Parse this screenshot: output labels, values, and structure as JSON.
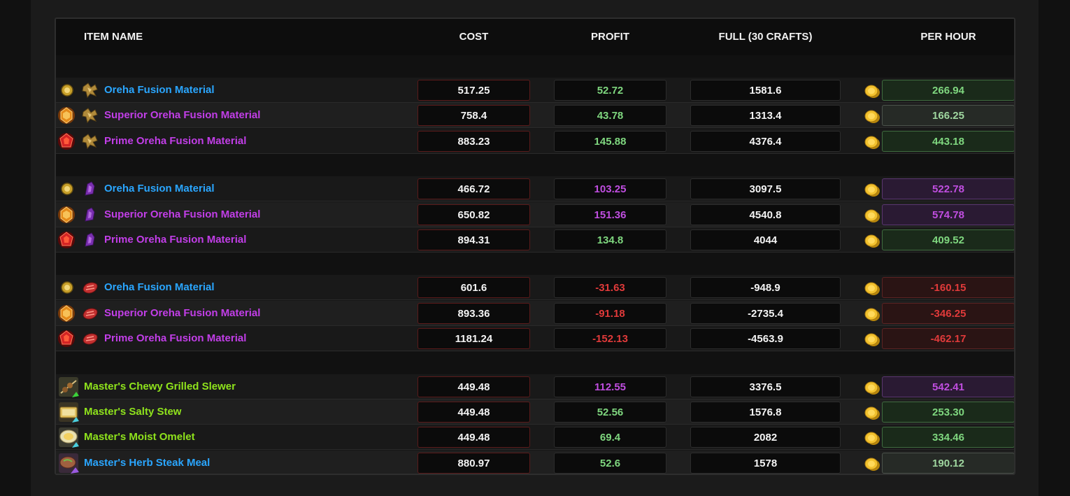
{
  "headers": {
    "item_name": "ITEM NAME",
    "cost": "COST",
    "profit": "PROFIT",
    "full": "FULL (30 CRAFTS)",
    "per_hour": "PER HOUR"
  },
  "colors": {
    "name_blue": "#2aa6ff",
    "name_purple": "#c23ee8",
    "name_green": "#8fe31c",
    "profit_green": "#7fd77f",
    "profit_purple": "#c04ee0",
    "loss_red": "#e03a3a"
  },
  "groups": [
    {
      "material_icon": "gold-relic-material-icon",
      "rows": [
        {
          "name": "Oreha Fusion Material",
          "tier_icon": "basic-oreha-icon",
          "name_color": "blue",
          "cost": "517.25",
          "profit": "52.72",
          "profit_class": "pos",
          "full": "1581.6",
          "per_hour": "266.94",
          "ph_class": "green"
        },
        {
          "name": "Superior Oreha Fusion Material",
          "tier_icon": "superior-oreha-icon",
          "name_color": "purple",
          "cost": "758.4",
          "profit": "43.78",
          "profit_class": "pos",
          "full": "1313.4",
          "per_hour": "166.25",
          "ph_class": "gray"
        },
        {
          "name": "Prime Oreha Fusion Material",
          "tier_icon": "prime-oreha-icon",
          "name_color": "purple",
          "cost": "883.23",
          "profit": "145.88",
          "profit_class": "pos",
          "full": "4376.4",
          "per_hour": "443.18",
          "ph_class": "green"
        }
      ]
    },
    {
      "material_icon": "purple-fish-material-icon",
      "rows": [
        {
          "name": "Oreha Fusion Material",
          "tier_icon": "basic-oreha-icon",
          "name_color": "blue",
          "cost": "466.72",
          "profit": "103.25",
          "profit_class": "high",
          "full": "3097.5",
          "per_hour": "522.78",
          "ph_class": "purple"
        },
        {
          "name": "Superior Oreha Fusion Material",
          "tier_icon": "superior-oreha-icon",
          "name_color": "purple",
          "cost": "650.82",
          "profit": "151.36",
          "profit_class": "high",
          "full": "4540.8",
          "per_hour": "574.78",
          "ph_class": "purple"
        },
        {
          "name": "Prime Oreha Fusion Material",
          "tier_icon": "prime-oreha-icon",
          "name_color": "purple",
          "cost": "894.31",
          "profit": "134.8",
          "profit_class": "pos",
          "full": "4044",
          "per_hour": "409.52",
          "ph_class": "green"
        }
      ]
    },
    {
      "material_icon": "red-meat-material-icon",
      "rows": [
        {
          "name": "Oreha Fusion Material",
          "tier_icon": "basic-oreha-icon",
          "name_color": "blue",
          "cost": "601.6",
          "profit": "-31.63",
          "profit_class": "neg",
          "full": "-948.9",
          "per_hour": "-160.15",
          "ph_class": "red"
        },
        {
          "name": "Superior Oreha Fusion Material",
          "tier_icon": "superior-oreha-icon",
          "name_color": "purple",
          "cost": "893.36",
          "profit": "-91.18",
          "profit_class": "neg",
          "full": "-2735.4",
          "per_hour": "-346.25",
          "ph_class": "red"
        },
        {
          "name": "Prime Oreha Fusion Material",
          "tier_icon": "prime-oreha-icon",
          "name_color": "purple",
          "cost": "1181.24",
          "profit": "-152.13",
          "profit_class": "neg",
          "full": "-4563.9",
          "per_hour": "-462.17",
          "ph_class": "red"
        }
      ]
    },
    {
      "material_icon": "",
      "rows": [
        {
          "name": "Master's Chewy Grilled Slewer",
          "tier_icon": "grilled-skewer-food-icon",
          "name_color": "green",
          "cost": "449.48",
          "profit": "112.55",
          "profit_class": "high",
          "full": "3376.5",
          "per_hour": "542.41",
          "ph_class": "purple"
        },
        {
          "name": "Master's Salty Stew",
          "tier_icon": "salty-stew-food-icon",
          "name_color": "green",
          "cost": "449.48",
          "profit": "52.56",
          "profit_class": "pos",
          "full": "1576.8",
          "per_hour": "253.30",
          "ph_class": "green"
        },
        {
          "name": "Master's Moist Omelet",
          "tier_icon": "omelet-food-icon",
          "name_color": "green",
          "cost": "449.48",
          "profit": "69.4",
          "profit_class": "pos",
          "full": "2082",
          "per_hour": "334.46",
          "ph_class": "green"
        },
        {
          "name": "Master's Herb Steak Meal",
          "tier_icon": "herb-steak-food-icon",
          "name_color": "blue",
          "cost": "880.97",
          "profit": "52.6",
          "profit_class": "pos",
          "full": "1578",
          "per_hour": "190.12",
          "ph_class": "gray"
        }
      ]
    }
  ]
}
